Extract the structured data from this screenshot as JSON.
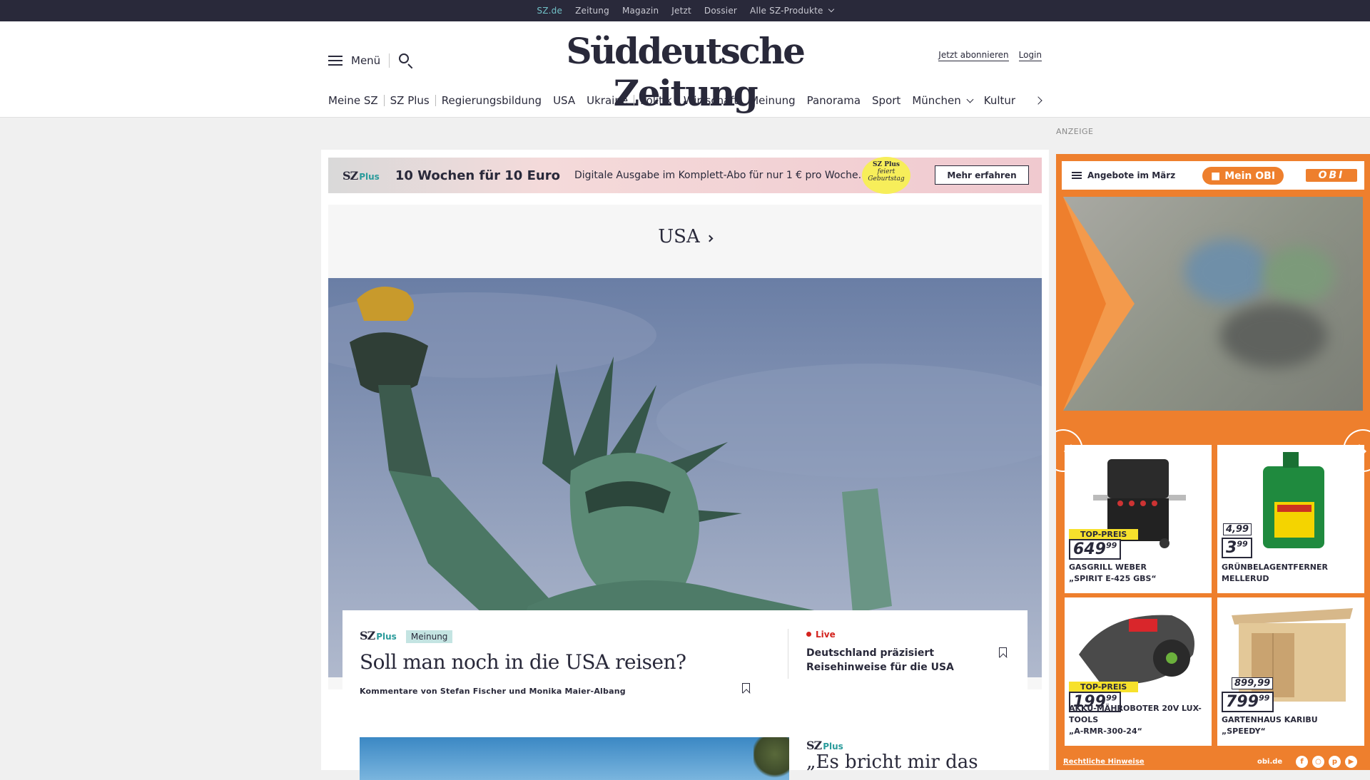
{
  "topbar": {
    "links": [
      "SZ.de",
      "Zeitung",
      "Magazin",
      "Jetzt",
      "Dossier",
      "Alle SZ-Produkte"
    ]
  },
  "header": {
    "menu_label": "Menü",
    "logo": "Süddeutsche Zeitung",
    "subscribe": "Jetzt abonnieren",
    "login": "Login"
  },
  "nav": {
    "items": [
      "Meine SZ",
      "SZ Plus",
      "Regierungsbildung",
      "USA",
      "Ukraine",
      "Politik",
      "Wirtschaft",
      "Meinung",
      "Panorama",
      "Sport",
      "München",
      "Kultur"
    ]
  },
  "promo": {
    "brand_sz": "SZ",
    "brand_plus": "Plus",
    "headline": "10 Wochen für 10 Euro",
    "text": "Digitale Ausgabe im Komplett-Abo für nur 1 € pro Woche.",
    "badge_line1": "SZ Plus",
    "badge_line2": "feiert",
    "badge_line3": "Geburtstag",
    "cta": "Mehr erfahren"
  },
  "section": {
    "title": "USA"
  },
  "lead_article": {
    "brand_sz": "SZ",
    "brand_plus": "Plus",
    "tag": "Meinung",
    "title": "Soll man noch in die USA reisen?",
    "byline": "Kommentare von Stefan Fischer und Monika Maier-Albang"
  },
  "live_article": {
    "label": "Live",
    "title": "Deutschland präzisiert Reisehinweise für die USA"
  },
  "second_article": {
    "brand_sz": "SZ",
    "brand_plus": "Plus",
    "title": "„Es bricht mir das"
  },
  "ad": {
    "label": "ANZEIGE",
    "menu_label": "Angebote im März",
    "mein_obi": "Mein OBI",
    "logo": "OBI",
    "products": [
      {
        "toppreis": "TOP-PREIS",
        "price": "649",
        "cents": "99",
        "name_1": "Gasgrill Weber",
        "name_2": "„Spirit E-425 GBS“"
      },
      {
        "old_price": "4,99",
        "price": "3",
        "cents": "99",
        "name_1": "Grünbelagentferner",
        "name_2": "Mellerud"
      },
      {
        "toppreis": "TOP-PREIS",
        "price": "199",
        "cents": "99",
        "name_1": "Akku-Mähroboter 20V Lux-Tools",
        "name_2": "„A-RMR-300-24“"
      },
      {
        "old_price": "899,99",
        "price": "799",
        "cents": "99",
        "name_1": "Gartenhaus Karibu „Speedy“",
        "name_2": ""
      }
    ],
    "footer_note": "Rechtliche Hinweise",
    "domain": "obi.de"
  },
  "colors": {
    "dark": "#29293a",
    "accent_teal": "#71c0c7",
    "obi_orange": "#ee7f2d",
    "live_red": "#d4231e"
  }
}
